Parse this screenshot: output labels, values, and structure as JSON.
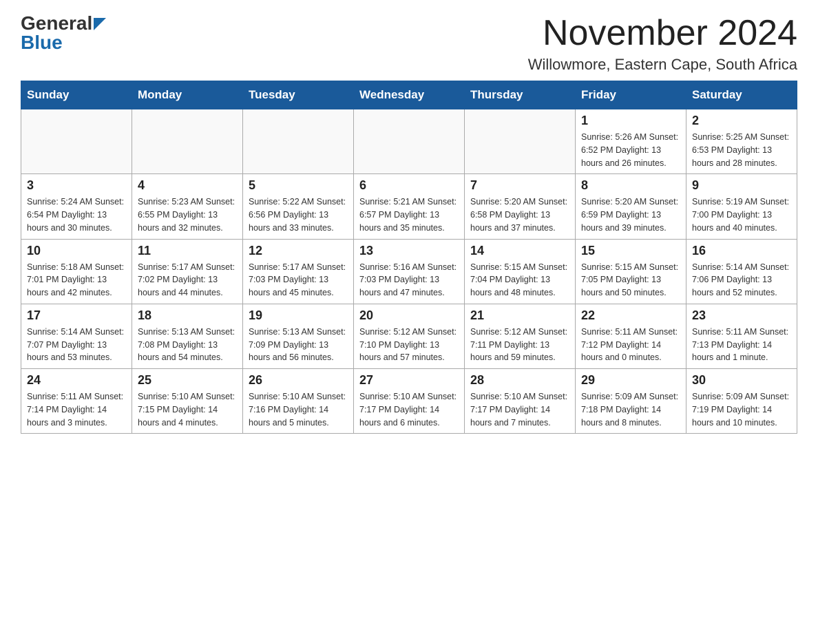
{
  "header": {
    "logo_general": "General",
    "logo_blue": "Blue",
    "title": "November 2024",
    "subtitle": "Willowmore, Eastern Cape, South Africa"
  },
  "days_of_week": [
    "Sunday",
    "Monday",
    "Tuesday",
    "Wednesday",
    "Thursday",
    "Friday",
    "Saturday"
  ],
  "weeks": [
    {
      "days": [
        {
          "number": "",
          "info": ""
        },
        {
          "number": "",
          "info": ""
        },
        {
          "number": "",
          "info": ""
        },
        {
          "number": "",
          "info": ""
        },
        {
          "number": "",
          "info": ""
        },
        {
          "number": "1",
          "info": "Sunrise: 5:26 AM\nSunset: 6:52 PM\nDaylight: 13 hours and 26 minutes."
        },
        {
          "number": "2",
          "info": "Sunrise: 5:25 AM\nSunset: 6:53 PM\nDaylight: 13 hours and 28 minutes."
        }
      ]
    },
    {
      "days": [
        {
          "number": "3",
          "info": "Sunrise: 5:24 AM\nSunset: 6:54 PM\nDaylight: 13 hours and 30 minutes."
        },
        {
          "number": "4",
          "info": "Sunrise: 5:23 AM\nSunset: 6:55 PM\nDaylight: 13 hours and 32 minutes."
        },
        {
          "number": "5",
          "info": "Sunrise: 5:22 AM\nSunset: 6:56 PM\nDaylight: 13 hours and 33 minutes."
        },
        {
          "number": "6",
          "info": "Sunrise: 5:21 AM\nSunset: 6:57 PM\nDaylight: 13 hours and 35 minutes."
        },
        {
          "number": "7",
          "info": "Sunrise: 5:20 AM\nSunset: 6:58 PM\nDaylight: 13 hours and 37 minutes."
        },
        {
          "number": "8",
          "info": "Sunrise: 5:20 AM\nSunset: 6:59 PM\nDaylight: 13 hours and 39 minutes."
        },
        {
          "number": "9",
          "info": "Sunrise: 5:19 AM\nSunset: 7:00 PM\nDaylight: 13 hours and 40 minutes."
        }
      ]
    },
    {
      "days": [
        {
          "number": "10",
          "info": "Sunrise: 5:18 AM\nSunset: 7:01 PM\nDaylight: 13 hours and 42 minutes."
        },
        {
          "number": "11",
          "info": "Sunrise: 5:17 AM\nSunset: 7:02 PM\nDaylight: 13 hours and 44 minutes."
        },
        {
          "number": "12",
          "info": "Sunrise: 5:17 AM\nSunset: 7:03 PM\nDaylight: 13 hours and 45 minutes."
        },
        {
          "number": "13",
          "info": "Sunrise: 5:16 AM\nSunset: 7:03 PM\nDaylight: 13 hours and 47 minutes."
        },
        {
          "number": "14",
          "info": "Sunrise: 5:15 AM\nSunset: 7:04 PM\nDaylight: 13 hours and 48 minutes."
        },
        {
          "number": "15",
          "info": "Sunrise: 5:15 AM\nSunset: 7:05 PM\nDaylight: 13 hours and 50 minutes."
        },
        {
          "number": "16",
          "info": "Sunrise: 5:14 AM\nSunset: 7:06 PM\nDaylight: 13 hours and 52 minutes."
        }
      ]
    },
    {
      "days": [
        {
          "number": "17",
          "info": "Sunrise: 5:14 AM\nSunset: 7:07 PM\nDaylight: 13 hours and 53 minutes."
        },
        {
          "number": "18",
          "info": "Sunrise: 5:13 AM\nSunset: 7:08 PM\nDaylight: 13 hours and 54 minutes."
        },
        {
          "number": "19",
          "info": "Sunrise: 5:13 AM\nSunset: 7:09 PM\nDaylight: 13 hours and 56 minutes."
        },
        {
          "number": "20",
          "info": "Sunrise: 5:12 AM\nSunset: 7:10 PM\nDaylight: 13 hours and 57 minutes."
        },
        {
          "number": "21",
          "info": "Sunrise: 5:12 AM\nSunset: 7:11 PM\nDaylight: 13 hours and 59 minutes."
        },
        {
          "number": "22",
          "info": "Sunrise: 5:11 AM\nSunset: 7:12 PM\nDaylight: 14 hours and 0 minutes."
        },
        {
          "number": "23",
          "info": "Sunrise: 5:11 AM\nSunset: 7:13 PM\nDaylight: 14 hours and 1 minute."
        }
      ]
    },
    {
      "days": [
        {
          "number": "24",
          "info": "Sunrise: 5:11 AM\nSunset: 7:14 PM\nDaylight: 14 hours and 3 minutes."
        },
        {
          "number": "25",
          "info": "Sunrise: 5:10 AM\nSunset: 7:15 PM\nDaylight: 14 hours and 4 minutes."
        },
        {
          "number": "26",
          "info": "Sunrise: 5:10 AM\nSunset: 7:16 PM\nDaylight: 14 hours and 5 minutes."
        },
        {
          "number": "27",
          "info": "Sunrise: 5:10 AM\nSunset: 7:17 PM\nDaylight: 14 hours and 6 minutes."
        },
        {
          "number": "28",
          "info": "Sunrise: 5:10 AM\nSunset: 7:17 PM\nDaylight: 14 hours and 7 minutes."
        },
        {
          "number": "29",
          "info": "Sunrise: 5:09 AM\nSunset: 7:18 PM\nDaylight: 14 hours and 8 minutes."
        },
        {
          "number": "30",
          "info": "Sunrise: 5:09 AM\nSunset: 7:19 PM\nDaylight: 14 hours and 10 minutes."
        }
      ]
    }
  ]
}
